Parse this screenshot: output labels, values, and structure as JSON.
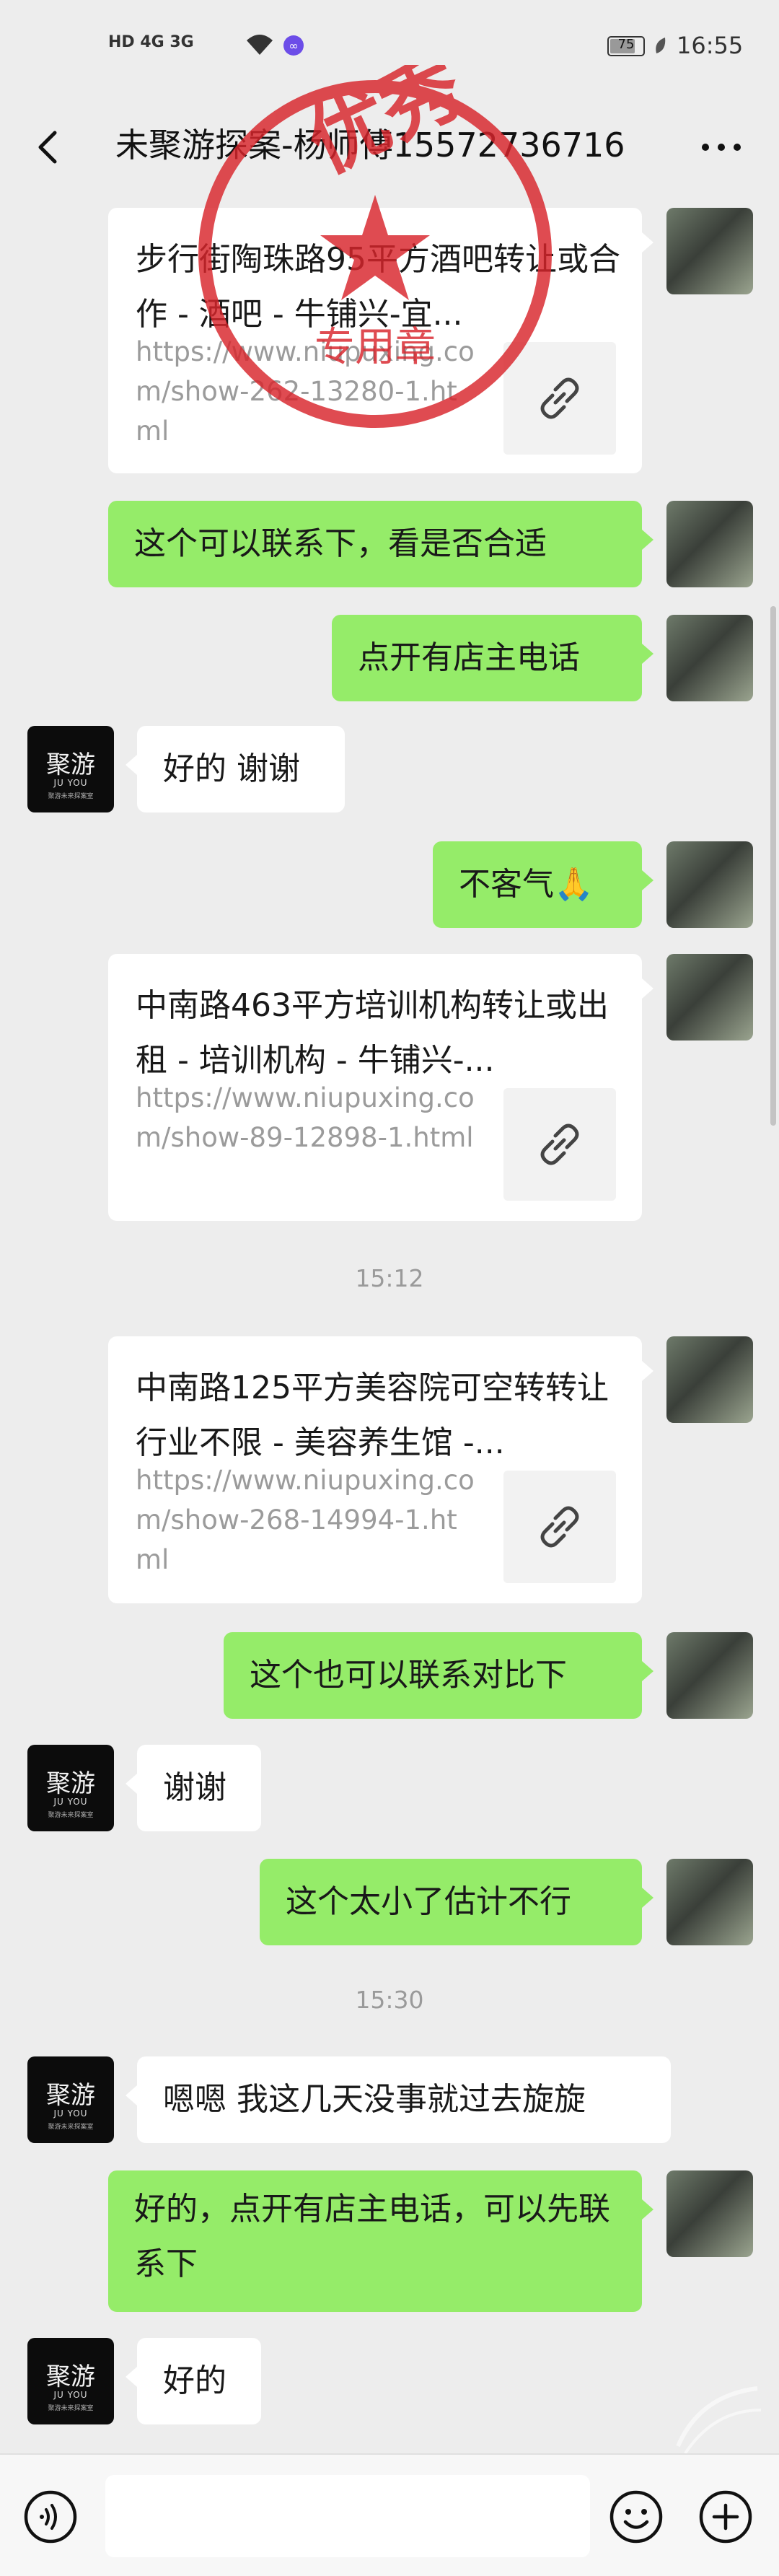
{
  "status_bar": {
    "left_icons": "HD 4G 3G",
    "battery": "75",
    "time": "16:55"
  },
  "header": {
    "title": "未聚游探案-杨师傅15572736716",
    "back_icon": "chevron-left-icon",
    "more_icon": "more-dots-icon"
  },
  "stamp": {
    "top_text": "优秀",
    "bottom_text": "专用章",
    "color": "#d8242b"
  },
  "avatar_other": {
    "line1": "聚游",
    "line2": "JU YOU",
    "line3": "聚游未来探案室"
  },
  "messages": [
    {
      "type": "link_card",
      "side": "me",
      "title": "步行街陶珠路95平方酒吧转让或合作 - 酒吧 - 牛铺兴-宜...",
      "url": "https://www.niupuxing.com/show-262-13280-1.html"
    },
    {
      "type": "text",
      "side": "me",
      "text": "这个可以联系下，看是否合适"
    },
    {
      "type": "text",
      "side": "me",
      "text": "点开有店主电话"
    },
    {
      "type": "text",
      "side": "other",
      "text": "好的 谢谢"
    },
    {
      "type": "text",
      "side": "me",
      "text": "不客气🙏"
    },
    {
      "type": "link_card",
      "side": "me",
      "title": "中南路463平方培训机构转让或出租 - 培训机构 - 牛铺兴-...",
      "url": "https://www.niupuxing.com/show-89-12898-1.html"
    },
    {
      "type": "time",
      "text": "15:12"
    },
    {
      "type": "link_card",
      "side": "me",
      "title": "中南路125平方美容院可空转转让行业不限 - 美容养生馆 -...",
      "url": "https://www.niupuxing.com/show-268-14994-1.html"
    },
    {
      "type": "text",
      "side": "me",
      "text": "这个也可以联系对比下"
    },
    {
      "type": "text",
      "side": "other",
      "text": "谢谢"
    },
    {
      "type": "text",
      "side": "me",
      "text": "这个太小了估计不行"
    },
    {
      "type": "time",
      "text": "15:30"
    },
    {
      "type": "text",
      "side": "other",
      "text": "嗯嗯 我这几天没事就过去旋旋"
    },
    {
      "type": "text",
      "side": "me",
      "text": "好的，点开有店主电话，可以先联系下"
    },
    {
      "type": "text",
      "side": "other",
      "text": "好的"
    }
  ],
  "input_bar": {
    "voice_icon": "voice-icon",
    "emoji_icon": "emoji-icon",
    "plus_icon": "plus-icon",
    "input_value": ""
  }
}
